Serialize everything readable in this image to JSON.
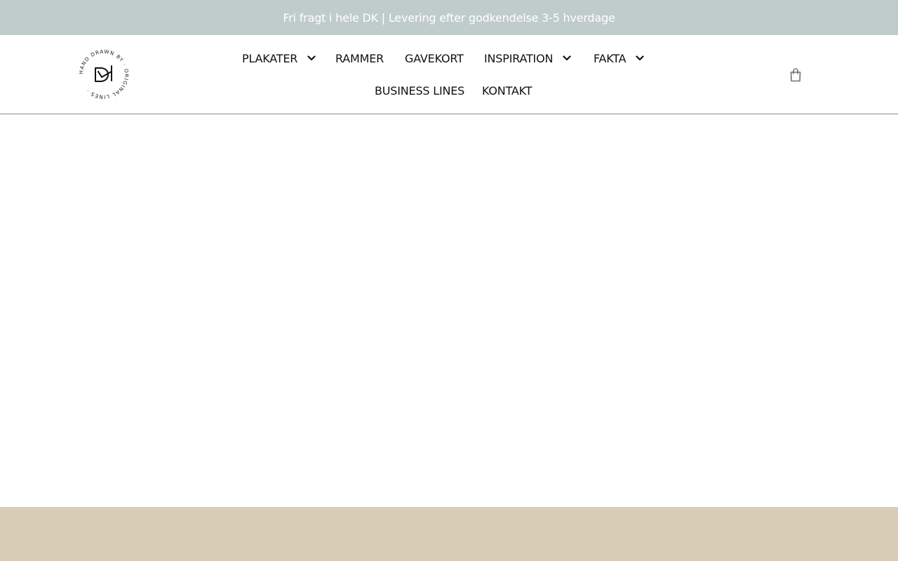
{
  "announcement": {
    "text": "Fri fragt i hele DK | Levering efter godkendelse 3-5 hverdage"
  },
  "logo": {
    "circular_text": "HAND DRAWN BY · ORIGINAL LINES ·",
    "icon": "original-lines-logo-mark"
  },
  "nav": {
    "items": [
      {
        "label": "PLAKATER",
        "has_dropdown": true
      },
      {
        "label": "RAMMER",
        "has_dropdown": false
      },
      {
        "label": "GAVEKORT",
        "has_dropdown": false
      },
      {
        "label": "INSPIRATION",
        "has_dropdown": true
      },
      {
        "label": "FAKTA",
        "has_dropdown": true
      },
      {
        "label": "BUSINESS LINES",
        "has_dropdown": false
      },
      {
        "label": "KONTAKT",
        "has_dropdown": false
      }
    ]
  },
  "cart": {
    "icon": "shopping-bag-icon"
  },
  "colors": {
    "announcement_bg": "#c0cccc",
    "announcement_text": "#ffffff",
    "footer_band": "#d9ccb6",
    "nav_text": "#111111"
  }
}
